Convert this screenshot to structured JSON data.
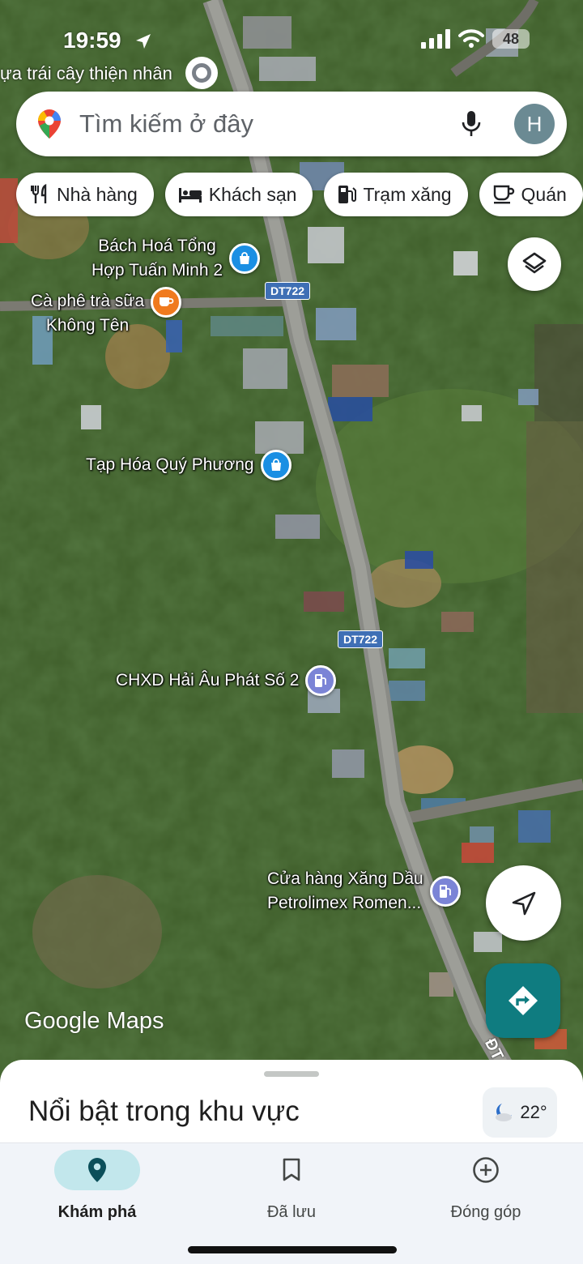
{
  "status_bar": {
    "time": "19:59",
    "battery": "48",
    "icons": [
      "location-arrow-icon",
      "signal-icon",
      "wifi-icon"
    ]
  },
  "top_place_label": "ựa trái cây thiện nhân",
  "search": {
    "placeholder": "Tìm kiếm ở đây",
    "avatar_initial": "H"
  },
  "chips": [
    {
      "label": "Nhà hàng",
      "icon": "fork-knife-icon"
    },
    {
      "label": "Khách sạn",
      "icon": "bed-icon"
    },
    {
      "label": "Trạm xăng",
      "icon": "gas-pump-icon"
    },
    {
      "label": "Quán",
      "icon": "coffee-cup-icon"
    }
  ],
  "map": {
    "roads": [
      {
        "label": "DT722"
      },
      {
        "label": "DT722"
      }
    ],
    "places": [
      {
        "name": "Bách Hoá Tổng\nHợp Tuấn Minh 2",
        "type": "shopping",
        "color": "#1a8fe3"
      },
      {
        "name": "Cà phê trà sữa\nKhông Tên",
        "type": "cafe",
        "color": "#f07a1e"
      },
      {
        "name": "Tạp Hóa Quý Phương",
        "type": "shopping",
        "color": "#1a8fe3"
      },
      {
        "name": "CHXD Hải Âu Phát Số 2",
        "type": "gas",
        "color": "#7b84d6"
      },
      {
        "name": "Cửa hàng Xăng Dầu\nPetrolimex Romen...",
        "type": "gas",
        "color": "#7b84d6"
      }
    ],
    "road_edge_label": "ĐT"
  },
  "brand": "Google Maps",
  "sheet": {
    "title": "Nổi bật trong khu vực",
    "weather": "22°"
  },
  "nav": [
    {
      "label": "Khám phá",
      "icon": "explore-pin-icon",
      "active": true
    },
    {
      "label": "Đã lưu",
      "icon": "bookmark-icon",
      "active": false
    },
    {
      "label": "Đóng góp",
      "icon": "add-circle-icon",
      "active": false
    }
  ],
  "colors": {
    "accent_teal": "#0f7c80",
    "nav_active": "#c2e7ec",
    "road_badge": "#3f6fb5"
  }
}
